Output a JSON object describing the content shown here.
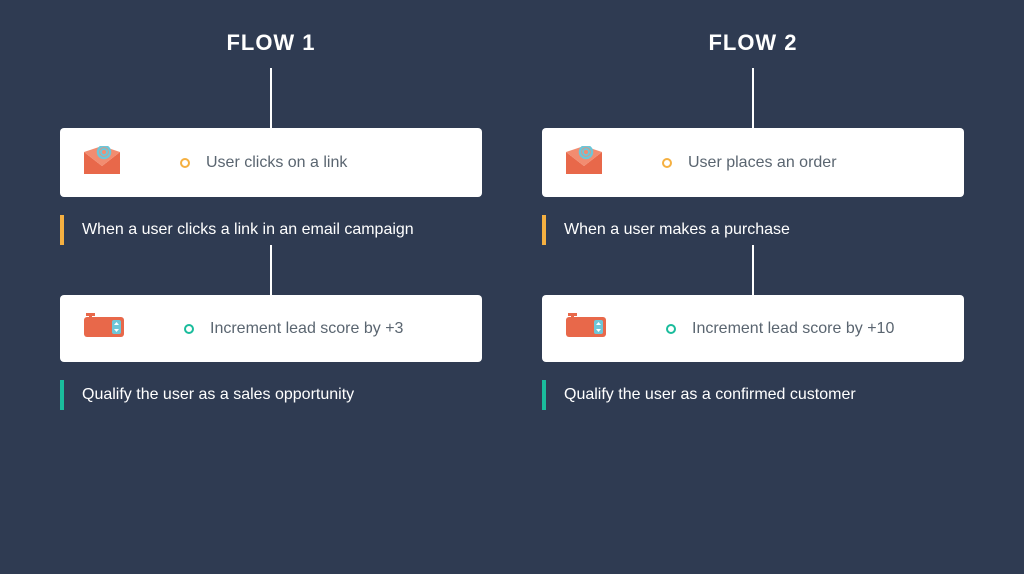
{
  "flows": [
    {
      "title": "FLOW 1",
      "trigger": {
        "label": "User clicks on a link",
        "description": "When a user clicks a link in an email campaign"
      },
      "action": {
        "label": "Increment lead score by +3",
        "description": "Qualify the user as a sales opportunity"
      }
    },
    {
      "title": "FLOW 2",
      "trigger": {
        "label": "User places an order",
        "description": "When a user makes a purchase"
      },
      "action": {
        "label": "Increment lead score by +10",
        "description": "Qualify the user as a confirmed customer"
      }
    }
  ],
  "colors": {
    "background": "#2f3b52",
    "card": "#ffffff",
    "trigger_accent": "#f5b041",
    "action_accent": "#1abc9c",
    "icon_primary": "#e8684a",
    "icon_secondary": "#6dc6d8"
  }
}
